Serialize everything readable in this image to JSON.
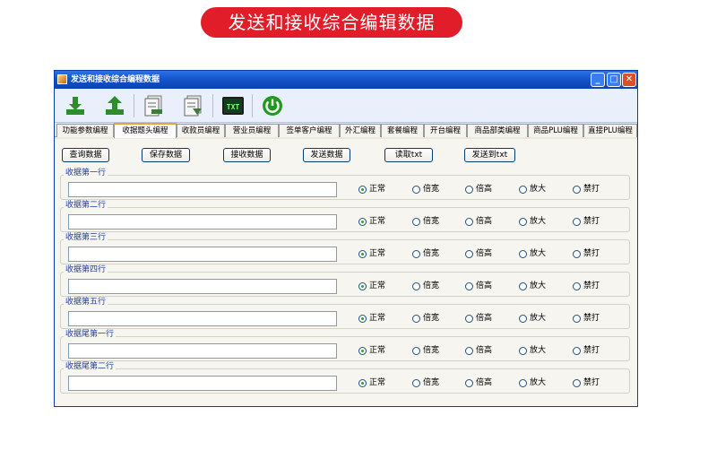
{
  "banner": {
    "title": "发送和接收综合编辑数据"
  },
  "window": {
    "title": "发送和接收综合编程数据",
    "controls": {
      "min": "_",
      "max": "□",
      "close": "✕"
    }
  },
  "toolbar": {
    "buttons": [
      {
        "name": "download-icon",
        "color": "#2e8b2e"
      },
      {
        "name": "upload-icon",
        "color": "#2e8b2e"
      },
      {
        "name": "document-stack-icon",
        "color": "#3d7a3d"
      },
      {
        "name": "document-import-icon",
        "color": "#3d7a3d"
      },
      {
        "name": "txt-icon",
        "label": "TXT",
        "color": "#1a7a3a"
      },
      {
        "name": "power-icon",
        "color": "#1f9a1f"
      }
    ]
  },
  "tabs": [
    "功能参数编程",
    "收据题头编程",
    "收款员编程",
    "营业员编程",
    "签单客户编程",
    "外汇编程",
    "套餐编程",
    "开台编程",
    "商品部类编程",
    "商品PLU编程",
    "直接PLU编程"
  ],
  "active_tab": "收据题头编程",
  "actions": [
    "查询数据",
    "保存数据",
    "接收数据",
    "发送数据",
    "读取txt",
    "发送到txt"
  ],
  "rows": [
    {
      "label": "收据第一行",
      "value": ""
    },
    {
      "label": "收据第二行",
      "value": ""
    },
    {
      "label": "收据第三行",
      "value": ""
    },
    {
      "label": "收据第四行",
      "value": ""
    },
    {
      "label": "收据第五行",
      "value": ""
    },
    {
      "label": "收据尾第一行",
      "value": ""
    },
    {
      "label": "收据尾第二行",
      "value": ""
    }
  ],
  "radio_options": [
    "正常",
    "倍宽",
    "倍高",
    "放大",
    "禁打"
  ],
  "selected_option": "正常"
}
